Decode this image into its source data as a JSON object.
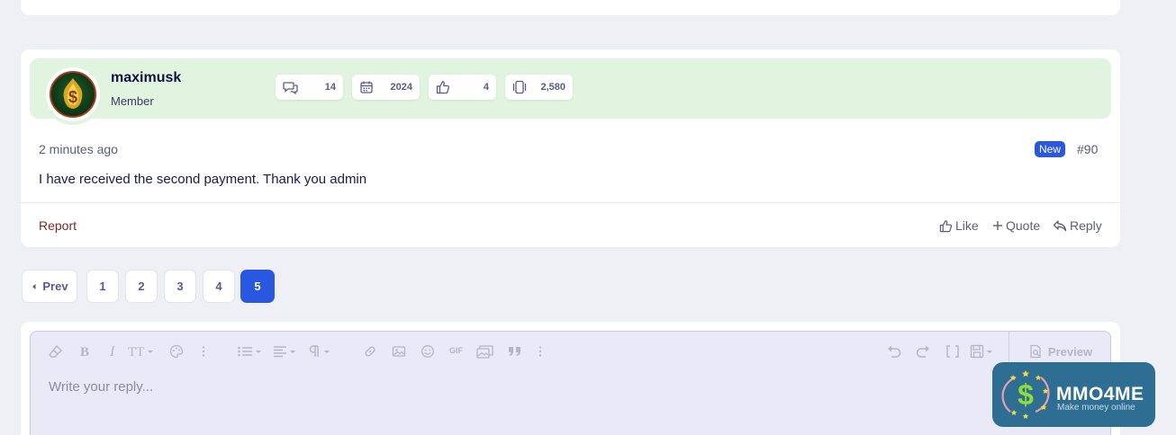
{
  "post": {
    "username": "maximusk",
    "user_title": "Member",
    "stats": {
      "messages": "14",
      "joined": "2024",
      "reactions": "4",
      "points": "2,580"
    },
    "time": "2 minutes ago",
    "new_badge": "New",
    "number": "#90",
    "body": "I have received the second payment. Thank you admin",
    "report_label": "Report",
    "like_label": "Like",
    "quote_label": "Quote",
    "reply_label": "Reply"
  },
  "pagination": {
    "prev_label": "Prev",
    "pages": [
      "1",
      "2",
      "3",
      "4",
      "5"
    ],
    "current": "5"
  },
  "editor": {
    "placeholder": "Write your reply...",
    "preview_label": "Preview",
    "gif_label": "GIF"
  },
  "logo": {
    "name": "MMO4ME",
    "tagline": "Make money online"
  },
  "colors": {
    "accent": "#2a57e0",
    "header_bg": "#e0f4df",
    "page_bg": "#eff0f5"
  }
}
